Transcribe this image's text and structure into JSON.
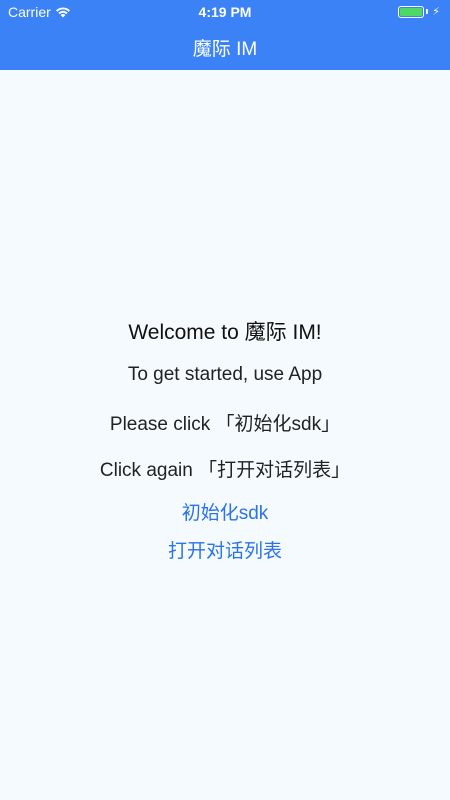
{
  "status_bar": {
    "carrier": "Carrier",
    "time": "4:19 PM",
    "wifi_icon": "wifi-icon",
    "battery_icon": "battery-icon",
    "battery_level": 1.0,
    "charging_icon": "bolt-icon"
  },
  "nav": {
    "title": "魔际 IM"
  },
  "main": {
    "welcome": "Welcome to 魔际 IM!",
    "instruction_1": "To get started, use App",
    "instruction_2": "Please click 「初始化sdk」",
    "instruction_3": "Click again 「打开对话列表」",
    "init_sdk_button": "初始化sdk",
    "open_conversation_button": "打开对话列表"
  },
  "colors": {
    "header": "#3b82f6",
    "background": "#f4fafd",
    "link": "#2a73e8",
    "battery": "#4cd964"
  }
}
